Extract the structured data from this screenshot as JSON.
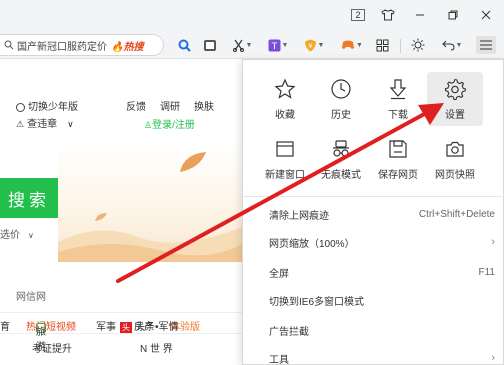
{
  "titlebar": {
    "badge": "2",
    "shirt_icon": "shirt-icon",
    "minimize": "—",
    "restore": "▢",
    "close": "✕"
  },
  "toolbar": {
    "address_text": "国产新冠口服药定价",
    "hot_label": "热搜",
    "hot_icon": "🔥"
  },
  "page": {
    "youth_mode": "切换少年版",
    "report": "查违章",
    "feedback": "反馈",
    "survey": "调研",
    "skin": "换肤",
    "login": "登录/注册",
    "search_label": "搜索",
    "hint": "选价",
    "nav": [
      "育",
      "旅游",
      "军事",
      "房产",
      "体验版"
    ],
    "net_bar": "网信网",
    "link1": "热门短视频",
    "link2": "头条•军情",
    "link3": "考证提升",
    "link4": "N 世 界"
  },
  "menu": {
    "quick": [
      {
        "label": "收藏",
        "icon": "star-icon"
      },
      {
        "label": "历史",
        "icon": "clock-icon"
      },
      {
        "label": "下载",
        "icon": "download-icon"
      },
      {
        "label": "设置",
        "icon": "gear-icon"
      },
      {
        "label": "新建窗口",
        "icon": "new-window-icon"
      },
      {
        "label": "无痕模式",
        "icon": "incognito-icon"
      },
      {
        "label": "保存网页",
        "icon": "save-page-icon"
      },
      {
        "label": "网页快照",
        "icon": "camera-icon"
      }
    ],
    "items": [
      {
        "label": "清除上网痕迹",
        "shortcut": "Ctrl+Shift+Delete",
        "arrow": ""
      },
      {
        "label": "网页缩放（100%）",
        "shortcut": "",
        "arrow": "›"
      },
      {
        "label": "全屏",
        "shortcut": "F11",
        "arrow": ""
      },
      {
        "label": "切换到IE6多窗口模式",
        "shortcut": "",
        "arrow": ""
      },
      {
        "label": "广告拦截",
        "shortcut": "",
        "arrow": ""
      },
      {
        "label": "工具",
        "shortcut": "",
        "arrow": "›"
      }
    ]
  },
  "colors": {
    "accent_green": "#22bf4c",
    "arrow_red": "#e02020",
    "hot_orange": "#e8461b"
  }
}
